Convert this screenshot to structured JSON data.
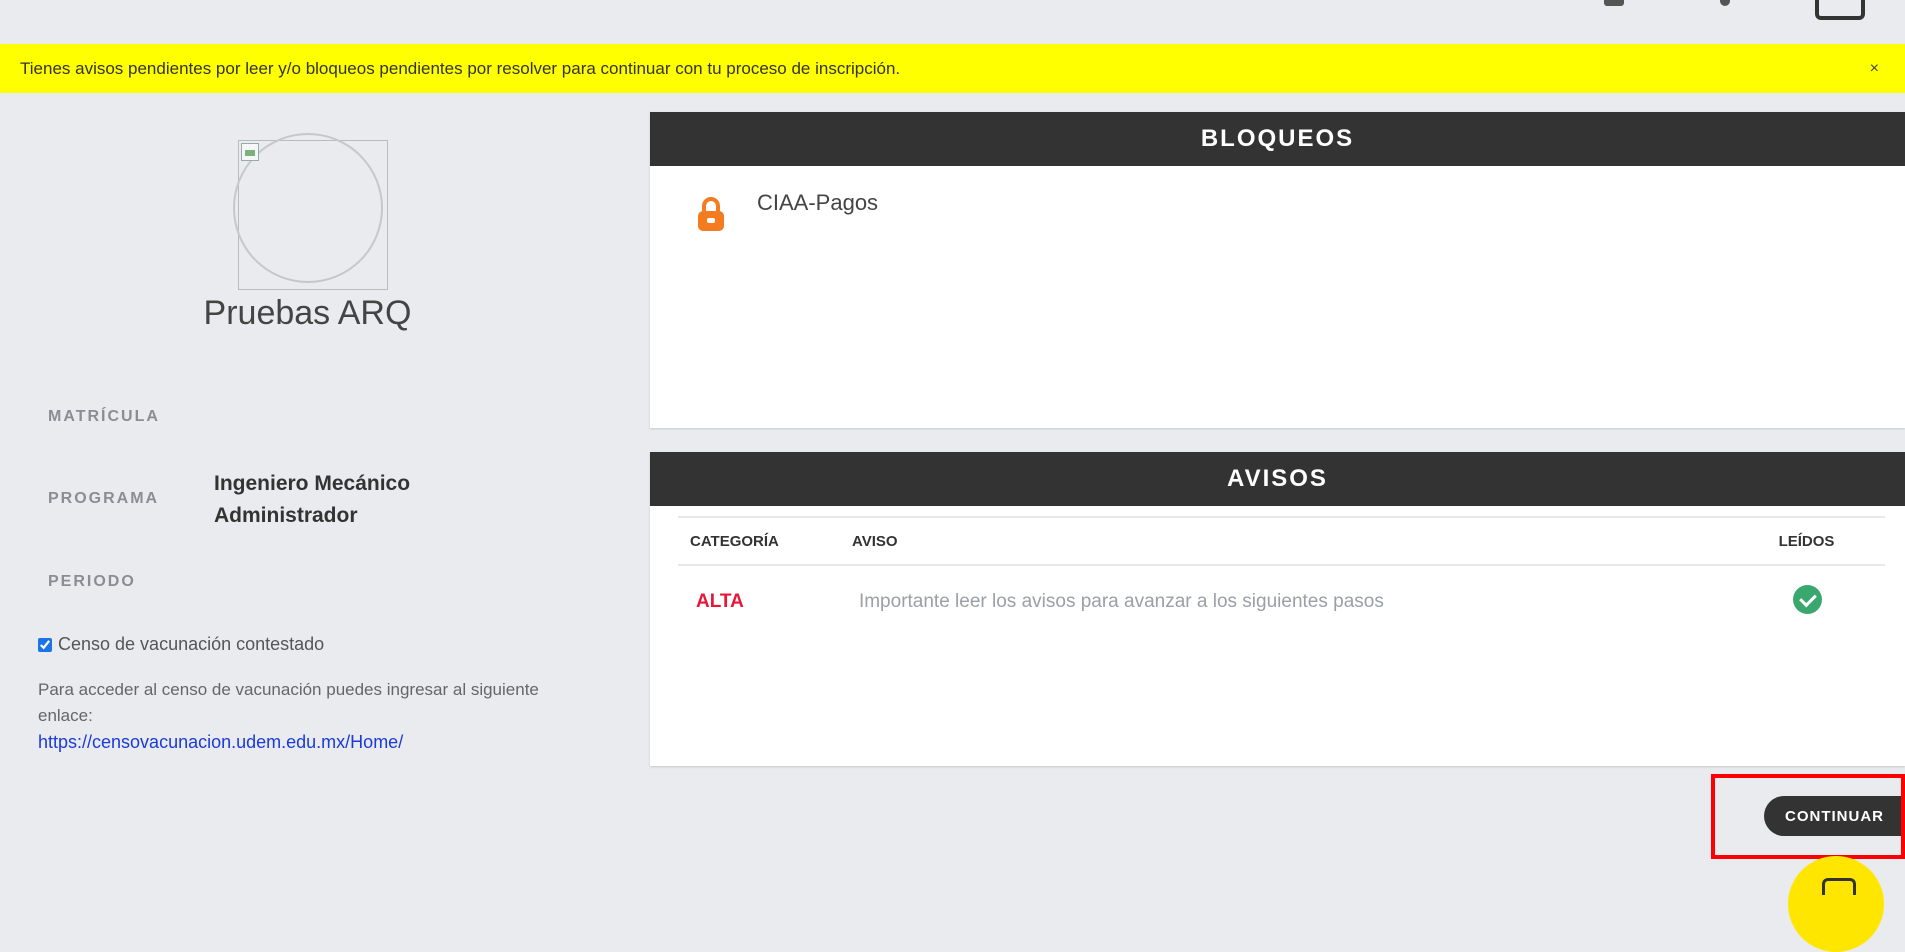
{
  "alert": {
    "message": "Tienes avisos pendientes por leer y/o bloqueos pendientes por resolver para continuar con tu proceso de inscripción.",
    "close": "×"
  },
  "profile": {
    "name": "Pruebas ARQ",
    "fields": {
      "matricula_label": "MATRÍCULA",
      "programa_label": "PROGRAMA",
      "programa_value": "Ingeniero Mecánico Administrador",
      "periodo_label": "PERIODO"
    },
    "censo": {
      "checkbox_label": "Censo de vacunación contestado",
      "checked": true,
      "info_text": "Para acceder al censo de vacunación puedes ingresar al siguiente enlace:",
      "link": "https://censovacunacion.udem.edu.mx/Home/"
    }
  },
  "bloqueos": {
    "title": "BLOQUEOS",
    "items": [
      {
        "icon": "lock-icon",
        "label": "CIAA-Pagos",
        "color": "#f47b20"
      }
    ]
  },
  "avisos": {
    "title": "AVISOS",
    "columns": {
      "categoria": "CATEGORÍA",
      "aviso": "AVISO",
      "leidos": "LEÍDOS"
    },
    "rows": [
      {
        "categoria": "ALTA",
        "aviso": "Importante leer los avisos para avanzar a los siguientes pasos",
        "leido": true
      }
    ]
  },
  "actions": {
    "continuar": "CONTINUAR"
  },
  "colors": {
    "alert_bg": "#ffff00",
    "header_bg": "#333333",
    "alta": "#e8173a",
    "check": "#3aa86e",
    "highlight": "#ff0000",
    "fab": "#ffe600"
  }
}
